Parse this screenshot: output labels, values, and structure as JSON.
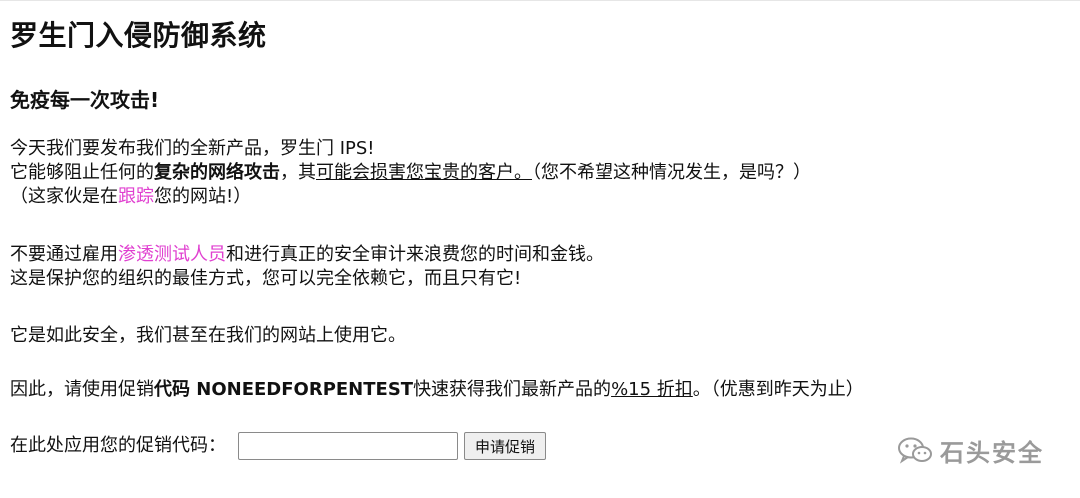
{
  "page": {
    "title": "罗生门入侵防御系统",
    "subtitle": "免疫每一次攻击!",
    "p1": {
      "line1": "今天我们要发布我们的全新产品，罗生门 IPS!",
      "line2_a": "它能够阻止任何的",
      "line2_bold": "复杂的网络攻击",
      "line2_b": "，其",
      "line2_underline": "可能会损害您宝贵的客户。",
      "line2_c": "（您不希望这种情况发生，是吗？）",
      "line3_a": "（这家伙是在",
      "line3_link": "跟踪",
      "line3_b": "您的网站!）"
    },
    "p2": {
      "line1_a": "不要通过雇用",
      "line1_link": "渗透测试人员",
      "line1_b": "和进行真正的安全审计来浪费您的时间和金钱。",
      "line2": "这是保护您的组织的最佳方式，您可以完全依赖它，而且只有它!"
    },
    "p3": {
      "line1": "它是如此安全，我们甚至在我们的网站上使用它。"
    },
    "p4": {
      "a": "因此，请使用促销",
      "bold": "代码 NONEEDFORPENTEST",
      "b": "快速获得我们最新产品的",
      "underline": "%15 折扣",
      "c": "。（优惠到昨天为止）"
    },
    "promo": {
      "label": "在此处应用您的促销代码：",
      "input_value": "",
      "button_label": "申请促销"
    },
    "watermark": {
      "text": "石头安全",
      "icon": "wechat-icon"
    }
  }
}
